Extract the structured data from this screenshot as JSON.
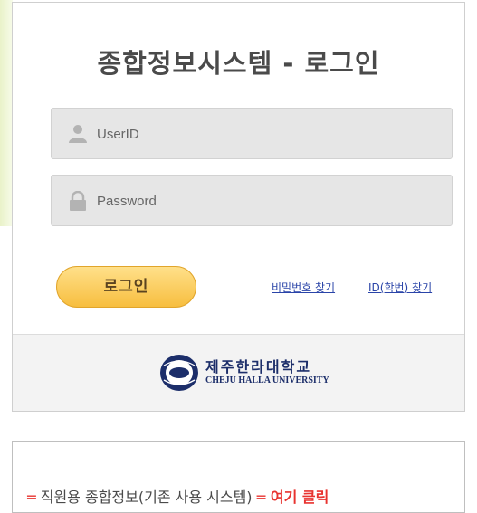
{
  "login": {
    "title": "종합정보시스템 - 로그인",
    "userid_placeholder": "UserID",
    "password_placeholder": "Password",
    "login_button": "로그인",
    "find_password": "비밀번호 찾기",
    "find_id": "ID(학번) 찾기"
  },
  "footer": {
    "university_name_kor": "제주한라대학교",
    "university_name_eng": "CHEJU HALLA UNIVERSITY"
  },
  "notice": {
    "prefix": "═",
    "text": " 직원용 종합정보(기존 사용 시스템) ",
    "suffix": "═",
    "click_text": " 여기 클릭"
  },
  "icons": {
    "user": "user-icon",
    "lock": "lock-icon",
    "logo": "university-seal-logo"
  },
  "colors": {
    "login_button": "#f7be3f",
    "link": "#2a44a8",
    "notice_red": "#e8332f",
    "logo_navy": "#1c2e6a"
  }
}
